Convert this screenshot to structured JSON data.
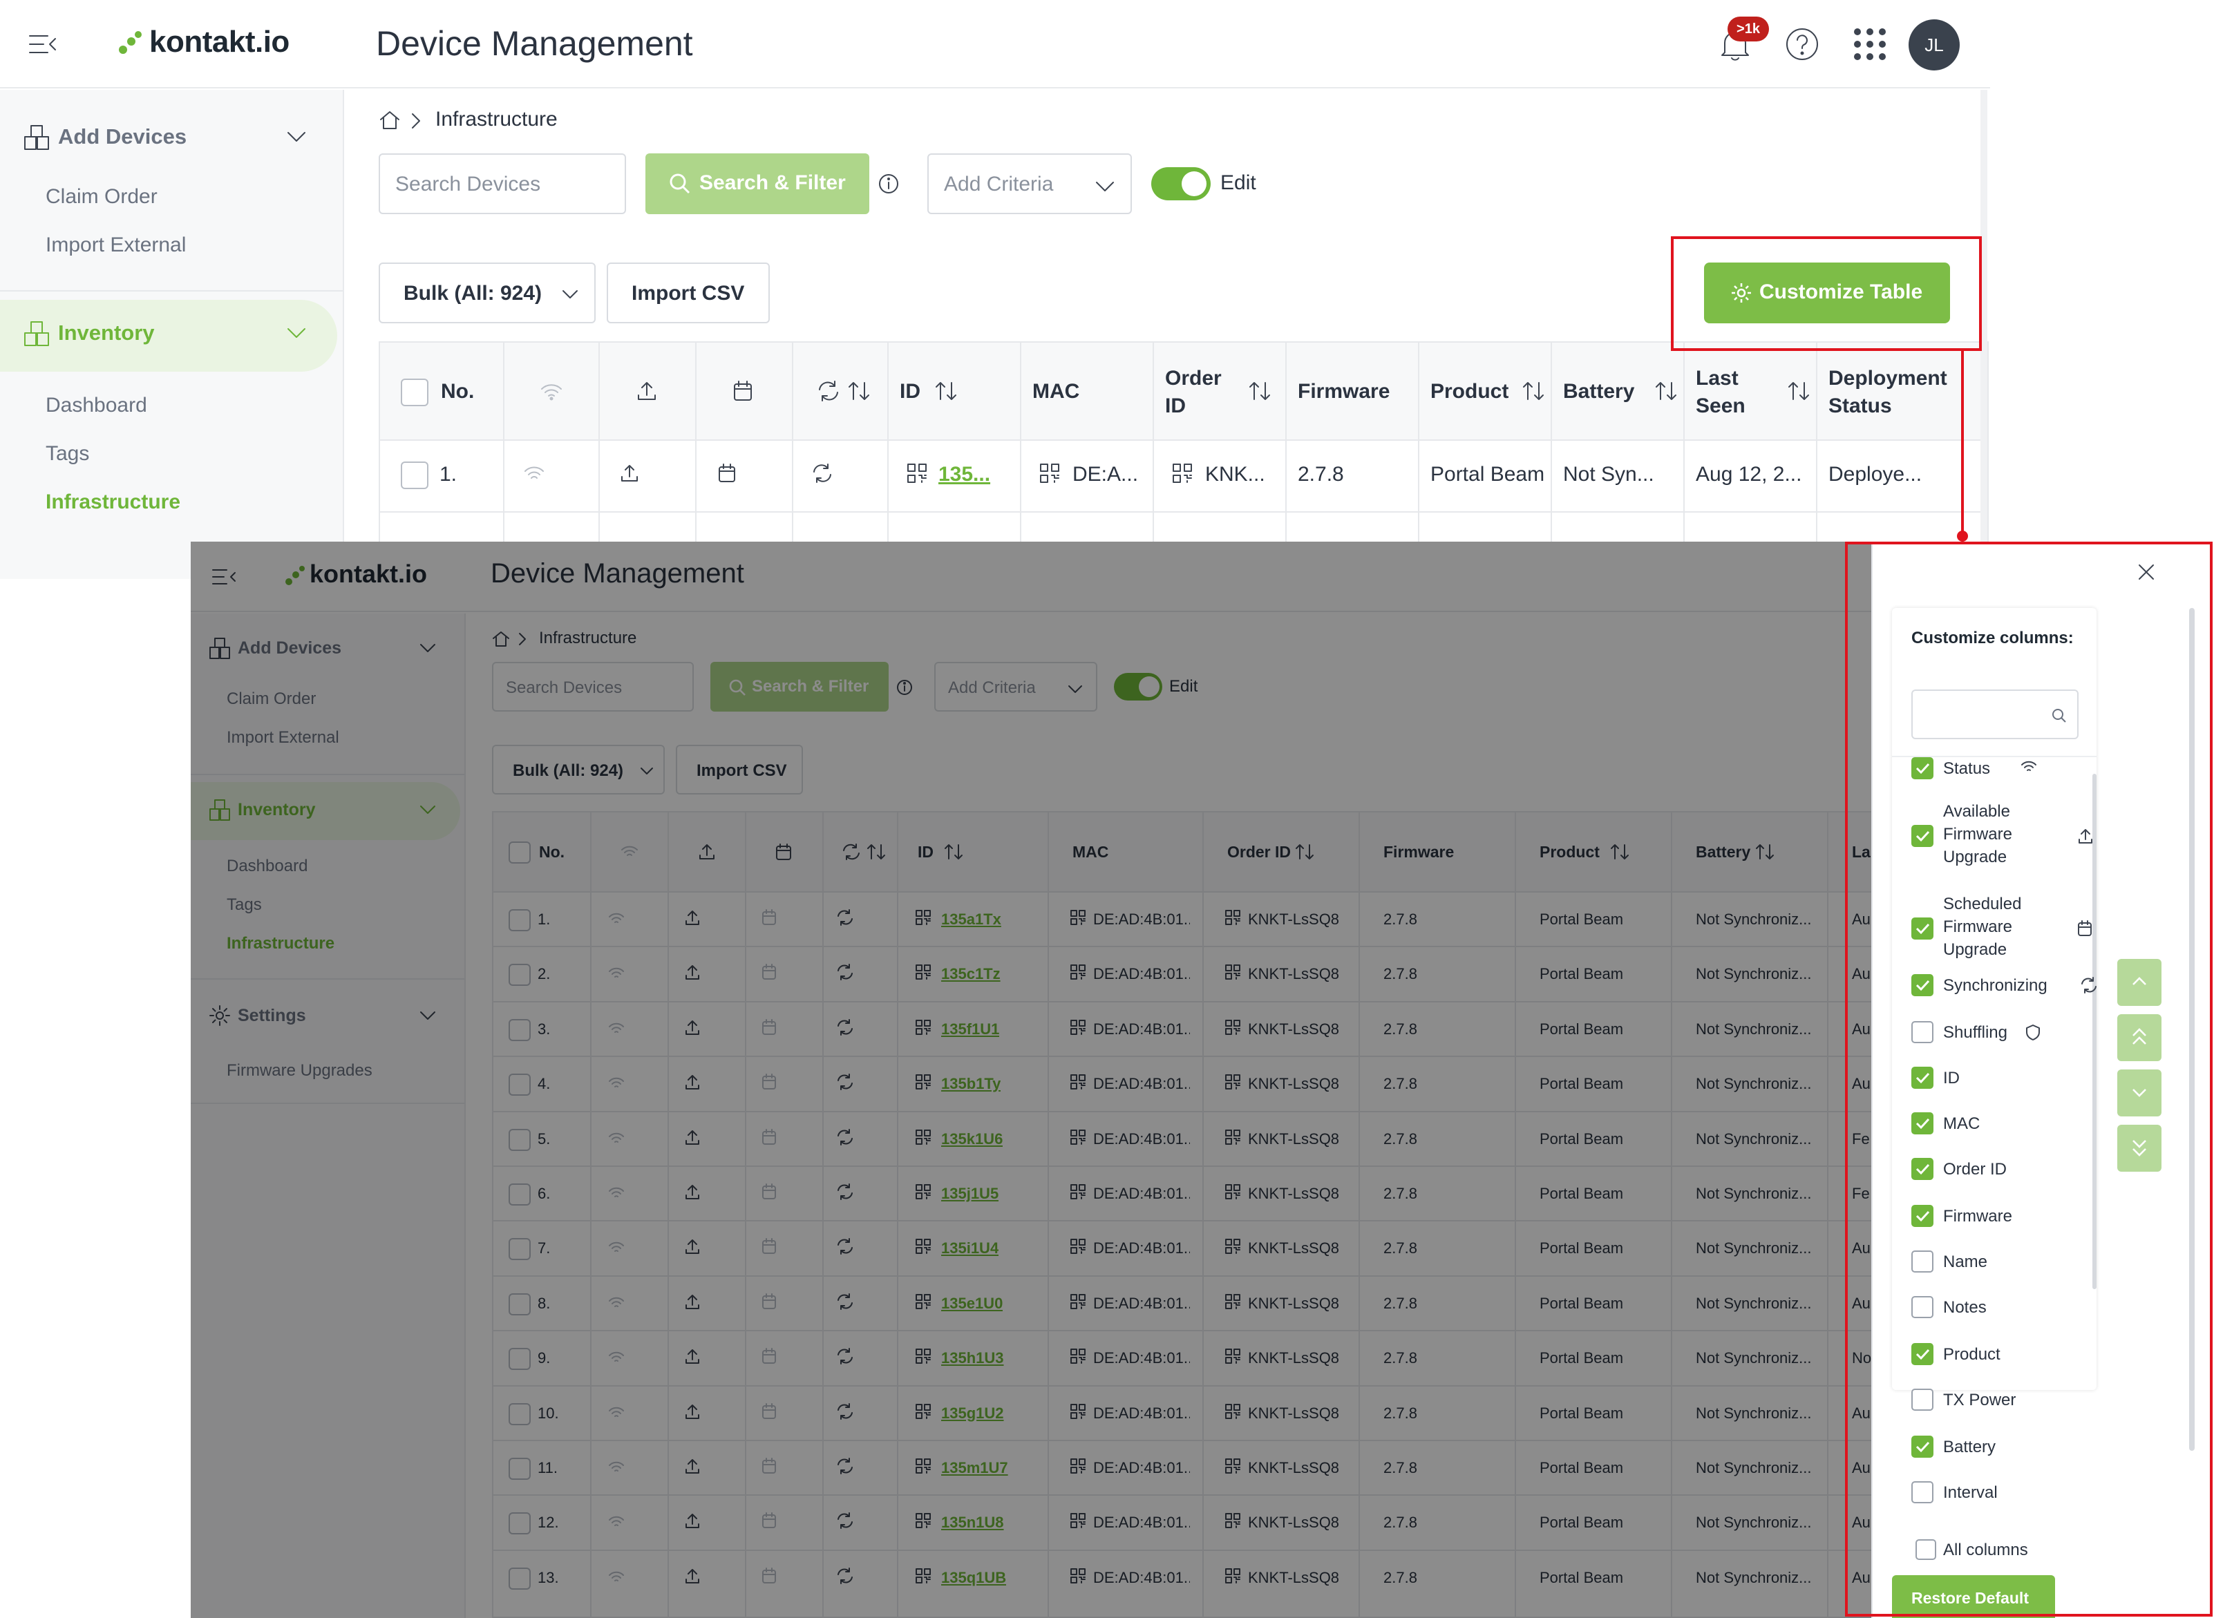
{
  "app": {
    "logo_text": "kontakt.io",
    "title": "Device Management",
    "notification_badge": ">1k",
    "avatar_initials": "JL"
  },
  "breadcrumb": {
    "current": "Infrastructure"
  },
  "sidebar": {
    "add_devices": {
      "label": "Add Devices",
      "items": [
        "Claim Order",
        "Import External"
      ]
    },
    "inventory": {
      "label": "Inventory",
      "items": [
        "Dashboard",
        "Tags",
        "Infrastructure"
      ]
    },
    "settings": {
      "label": "Settings",
      "items": [
        "Firmware Upgrades"
      ]
    }
  },
  "toolbar": {
    "search_placeholder": "Search Devices",
    "search_filter_label": "Search & Filter",
    "add_criteria_label": "Add Criteria",
    "edit_label": "Edit",
    "bulk_label": "Bulk (All: 924)",
    "import_csv_label": "Import CSV",
    "customize_table_label": "Customize Table"
  },
  "table_top": {
    "headers": [
      "No.",
      "ID",
      "MAC",
      "Order ID",
      "Firmware",
      "Product",
      "Battery",
      "Last Seen",
      "Deployment Status"
    ],
    "row": {
      "no": "1.",
      "id": "135...",
      "mac": "DE:A...",
      "order_id": "KNK...",
      "firmware": "2.7.8",
      "product": "Portal Beam",
      "battery": "Not Syn...",
      "last_seen": "Aug 12, 2...",
      "deployment": "Deploye..."
    }
  },
  "table_bottom": {
    "headers": [
      "No.",
      "ID",
      "MAC",
      "Order ID",
      "Firmware",
      "Product",
      "Battery",
      "La"
    ],
    "rows": [
      {
        "no": "1.",
        "id": "135a1Tx",
        "mac": "DE:AD:4B:01...",
        "order_id": "KNKT-LsSQ8",
        "firmware": "2.7.8",
        "product": "Portal Beam",
        "battery": "Not Synchroniz...",
        "last": "Au"
      },
      {
        "no": "2.",
        "id": "135c1Tz",
        "mac": "DE:AD:4B:01...",
        "order_id": "KNKT-LsSQ8",
        "firmware": "2.7.8",
        "product": "Portal Beam",
        "battery": "Not Synchroniz...",
        "last": "Au"
      },
      {
        "no": "3.",
        "id": "135f1U1",
        "mac": "DE:AD:4B:01...",
        "order_id": "KNKT-LsSQ8",
        "firmware": "2.7.8",
        "product": "Portal Beam",
        "battery": "Not Synchroniz...",
        "last": "Au"
      },
      {
        "no": "4.",
        "id": "135b1Ty",
        "mac": "DE:AD:4B:01...",
        "order_id": "KNKT-LsSQ8",
        "firmware": "2.7.8",
        "product": "Portal Beam",
        "battery": "Not Synchroniz...",
        "last": "Au"
      },
      {
        "no": "5.",
        "id": "135k1U6",
        "mac": "DE:AD:4B:01...",
        "order_id": "KNKT-LsSQ8",
        "firmware": "2.7.8",
        "product": "Portal Beam",
        "battery": "Not Synchroniz...",
        "last": "Fe"
      },
      {
        "no": "6.",
        "id": "135j1U5",
        "mac": "DE:AD:4B:01...",
        "order_id": "KNKT-LsSQ8",
        "firmware": "2.7.8",
        "product": "Portal Beam",
        "battery": "Not Synchroniz...",
        "last": "Fe"
      },
      {
        "no": "7.",
        "id": "135i1U4",
        "mac": "DE:AD:4B:01...",
        "order_id": "KNKT-LsSQ8",
        "firmware": "2.7.8",
        "product": "Portal Beam",
        "battery": "Not Synchroniz...",
        "last": "Au"
      },
      {
        "no": "8.",
        "id": "135e1U0",
        "mac": "DE:AD:4B:01...",
        "order_id": "KNKT-LsSQ8",
        "firmware": "2.7.8",
        "product": "Portal Beam",
        "battery": "Not Synchroniz...",
        "last": "Au"
      },
      {
        "no": "9.",
        "id": "135h1U3",
        "mac": "DE:AD:4B:01...",
        "order_id": "KNKT-LsSQ8",
        "firmware": "2.7.8",
        "product": "Portal Beam",
        "battery": "Not Synchroniz...",
        "last": "No"
      },
      {
        "no": "10.",
        "id": "135g1U2",
        "mac": "DE:AD:4B:01...",
        "order_id": "KNKT-LsSQ8",
        "firmware": "2.7.8",
        "product": "Portal Beam",
        "battery": "Not Synchroniz...",
        "last": "Au"
      },
      {
        "no": "11.",
        "id": "135m1U7",
        "mac": "DE:AD:4B:01...",
        "order_id": "KNKT-LsSQ8",
        "firmware": "2.7.8",
        "product": "Portal Beam",
        "battery": "Not Synchroniz...",
        "last": "Au"
      },
      {
        "no": "12.",
        "id": "135n1U8",
        "mac": "DE:AD:4B:01...",
        "order_id": "KNKT-LsSQ8",
        "firmware": "2.7.8",
        "product": "Portal Beam",
        "battery": "Not Synchroniz...",
        "last": "Au"
      },
      {
        "no": "13.",
        "id": "135q1UB",
        "mac": "DE:AD:4B:01...",
        "order_id": "KNKT-LsSQ8",
        "firmware": "2.7.8",
        "product": "Portal Beam",
        "battery": "Not Synchroniz...",
        "last": "Au"
      }
    ]
  },
  "customize_panel": {
    "title": "Customize columns:",
    "search_placeholder": "",
    "columns": [
      {
        "label": "Status",
        "checked": true,
        "icon": "wifi-icon"
      },
      {
        "label": "Available Firmware Upgrade",
        "checked": true,
        "icon": "upload-icon"
      },
      {
        "label": "Scheduled Firmware Upgrade",
        "checked": true,
        "icon": "calendar-icon"
      },
      {
        "label": "Synchronizing",
        "checked": true,
        "icon": "sync-icon"
      },
      {
        "label": "Shuffling",
        "checked": false,
        "icon": "shield-icon"
      },
      {
        "label": "ID",
        "checked": true
      },
      {
        "label": "MAC",
        "checked": true
      },
      {
        "label": "Order ID",
        "checked": true
      },
      {
        "label": "Firmware",
        "checked": true
      },
      {
        "label": "Name",
        "checked": false
      },
      {
        "label": "Notes",
        "checked": false
      },
      {
        "label": "Product",
        "checked": true
      },
      {
        "label": "TX Power",
        "checked": false
      },
      {
        "label": "Battery",
        "checked": true
      },
      {
        "label": "Interval",
        "checked": false
      }
    ],
    "all_columns_label": "All columns",
    "restore_default_label": "Restore Default"
  },
  "colors": {
    "accent": "#6fb63a",
    "annotation": "#e0141e"
  }
}
